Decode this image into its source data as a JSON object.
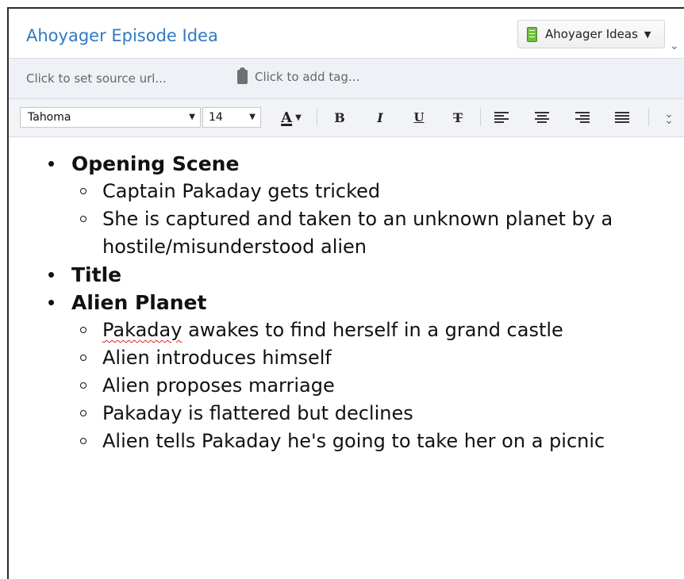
{
  "note": {
    "title": "Ahoyager Episode Idea",
    "notebook_label": "Ahoyager Ideas",
    "source_placeholder": "Click to set source url...",
    "tag_placeholder": "Click to add tag..."
  },
  "toolbar": {
    "font_family": "Tahoma",
    "font_size": "14",
    "font_color_label": "A",
    "bold_label": "B",
    "italic_label": "I",
    "underline_label": "U",
    "strike_label": "T"
  },
  "icons": {
    "notebook": "notebook-icon",
    "tag": "tag-icon",
    "expand": "chevron-down-icon",
    "more": "double-chevron-down-icon"
  },
  "colors": {
    "title": "#2f79c4",
    "spellcheck": "#dd2222",
    "notebook_icon": "#6fbf3a"
  },
  "content": {
    "sections": [
      {
        "heading": "Opening Scene",
        "items": [
          "Captain Pakaday gets tricked",
          "She is captured and taken to an unknown planet by a hostile/misunderstood alien"
        ]
      },
      {
        "heading": "Title",
        "items": []
      },
      {
        "heading": "Alien Planet",
        "items": [
          "Pakaday awakes to find herself in a grand castle",
          "Alien introduces himself",
          "Alien proposes marriage",
          "Pakaday is flattered but declines",
          "Alien tells Pakaday he's going to take her on a picnic"
        ]
      }
    ]
  }
}
